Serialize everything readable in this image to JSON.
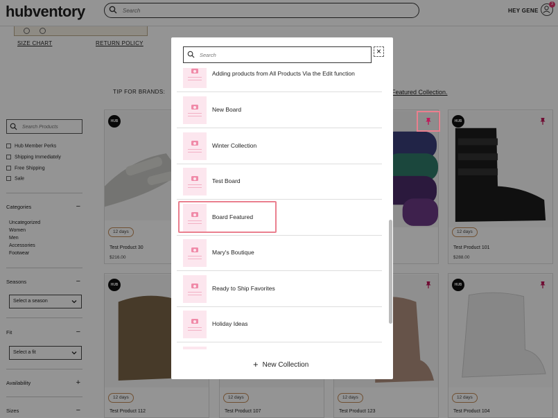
{
  "header": {
    "logo": "hubventory",
    "search_placeholder": "Search",
    "greeting": "HEY GENE",
    "cart_count": "3"
  },
  "page": {
    "size_chart": "SIZE CHART",
    "return_policy": "RETURN POLICY",
    "tip_text": "TIP FOR BRANDS:",
    "tip_link": "Featured Collection."
  },
  "sidebar": {
    "search_placeholder": "Search Products",
    "perks": [
      "Hub Member Perks",
      "Shipping Immediately",
      "Free Shipping",
      "Sale"
    ],
    "categories_title": "Categories",
    "categories": [
      "Uncategorized",
      "Women",
      "Men",
      "Accessories",
      "Footwear"
    ],
    "seasons_title": "Seasons",
    "season_select": "Select a season",
    "fit_title": "Fit",
    "fit_select": "Select a fit",
    "availability_title": "Availability",
    "sizes_title": "Sizes"
  },
  "products": [
    {
      "name": "Test Product 30",
      "price": "$216.00",
      "badge": "12 days",
      "hub": "HUB"
    },
    {
      "name": "Test Product 101",
      "price": "$288.00",
      "badge": "12 days",
      "hub": "HUB"
    },
    {
      "name": "Test Product 112",
      "badge": "12 days",
      "hub": "HUB"
    },
    {
      "name": "Test Product 107",
      "badge": "12 days"
    },
    {
      "name": "Test Product 123",
      "badge": "12 days"
    },
    {
      "name": "Test Product 104",
      "badge": "12 days",
      "hub": "HUB"
    }
  ],
  "modal": {
    "search_placeholder": "Search",
    "close_label": "×",
    "items": [
      "Adding products from All Products Via the Edit function",
      "New Board",
      "Winter Collection",
      "Test Board",
      "Board Featured",
      "Mary's Boutique",
      "Ready to Ship Favorites",
      "Holiday Ideas"
    ],
    "new_collection": "New Collection"
  },
  "colors": {
    "accent_pink": "#e03a6e",
    "highlight": "#ea7f8e",
    "badge_border": "#c28a56"
  }
}
